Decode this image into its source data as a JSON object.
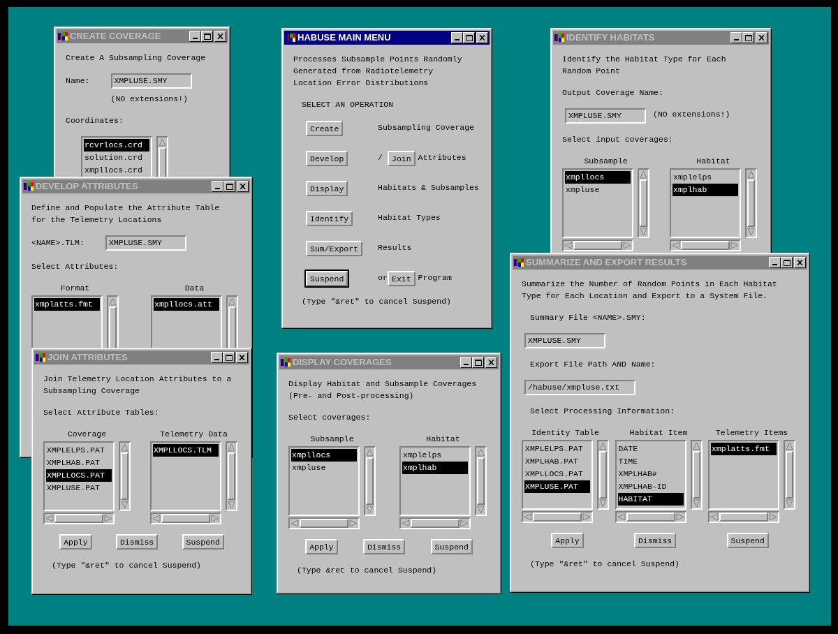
{
  "windows": [
    {
      "title": "CREATE COVERAGE",
      "active": false,
      "body": [
        {
          "kind": "paragraph",
          "text": "Create A Subsampling Coverage"
        },
        {
          "kind": "labeled_field",
          "label": "Name:",
          "value": "XMPLUSE.SMY",
          "note": "(NO extensions!)"
        },
        {
          "kind": "paragraph",
          "text": "Coordinates:"
        },
        {
          "kind": "lists",
          "lists": [
            {
              "items": [
                {
                  "text": "rcvrlocs.crd",
                  "selected": true
                },
                {
                  "text": "solution.crd",
                  "selected": false
                },
                {
                  "text": "xmpllocs.crd",
                  "selected": false
                }
              ]
            }
          ]
        }
      ]
    },
    {
      "title": "DEVELOP ATTRIBUTES",
      "active": false,
      "body": [
        {
          "kind": "paragraph",
          "text": "Define and Populate the Attribute Table\nfor the Telemetry Locations"
        },
        {
          "kind": "labeled_field",
          "label": "<NAME>.TLM:",
          "value": "XMPLUSE.SMY"
        },
        {
          "kind": "paragraph",
          "text": "Select Attributes:"
        },
        {
          "kind": "lists",
          "lists": [
            {
              "header": "Format",
              "items": [
                {
                  "text": "xmplatts.fmt",
                  "selected": true
                }
              ]
            },
            {
              "header": "Data",
              "items": [
                {
                  "text": "xmpllocs.att",
                  "selected": true
                }
              ]
            }
          ]
        }
      ]
    },
    {
      "title": "JOIN ATTRIBUTES",
      "active": false,
      "body": [
        {
          "kind": "paragraph",
          "text": "Join Telemetry Location Attributes to a\nSubsampling Coverage"
        },
        {
          "kind": "paragraph",
          "text": "Select Attribute Tables:"
        },
        {
          "kind": "lists",
          "lists": [
            {
              "header": "Coverage",
              "items": [
                {
                  "text": "XMPLELPS.PAT",
                  "selected": false
                },
                {
                  "text": "XMPLHAB.PAT",
                  "selected": false
                },
                {
                  "text": "XMPLLOCS.PAT",
                  "selected": true
                },
                {
                  "text": "XMPLUSE.PAT",
                  "selected": false
                }
              ]
            },
            {
              "header": "Telemetry Data",
              "items": [
                {
                  "text": "XMPLLOCS.TLM",
                  "selected": true
                }
              ]
            }
          ]
        },
        {
          "kind": "buttons",
          "buttons": [
            "Apply",
            "Dismiss",
            "Suspend"
          ]
        },
        {
          "kind": "paragraph",
          "text": "(Type \"&ret\" to cancel Suspend)",
          "indent": true
        }
      ]
    },
    {
      "title": "HABUSE MAIN MENU",
      "active": true,
      "body": [
        {
          "kind": "paragraph",
          "text": "Processes Subsample Points Randomly\nGenerated from Radiotelemetry\nLocation Error Distributions"
        },
        {
          "kind": "paragraph",
          "text": "SELECT AN OPERATION",
          "indent": true
        },
        {
          "kind": "menu",
          "rows": [
            {
              "button": {
                "label": "Create",
                "default": false
              },
              "text": "Subsampling Coverage"
            },
            {
              "button": {
                "label": "Develop",
                "default": false
              },
              "separator": "/",
              "second_button": {
                "label": "Join",
                "default": false
              },
              "text": "Attributes"
            },
            {
              "button": {
                "label": "Display",
                "default": false
              },
              "text": "Habitats & Subsamples"
            },
            {
              "button": {
                "label": "Identify",
                "default": false
              },
              "text": "Habitat Types"
            },
            {
              "button": {
                "label": "Sum/Export",
                "default": false
              },
              "text": "Results"
            },
            {
              "button": {
                "label": "Suspend",
                "default": true
              },
              "separator": "or",
              "second_button": {
                "label": "Exit",
                "default": false
              },
              "text": "Program"
            }
          ]
        },
        {
          "kind": "paragraph",
          "text": "(Type \"&ret\" to cancel Suspend)",
          "indent": true
        }
      ]
    },
    {
      "title": "DISPLAY COVERAGES",
      "active": false,
      "body": [
        {
          "kind": "paragraph",
          "text": "Display Habitat and Subsample Coverages\n(Pre- and Post-processing)"
        },
        {
          "kind": "paragraph",
          "text": "Select coverages:"
        },
        {
          "kind": "lists",
          "lists": [
            {
              "header": "Subsample",
              "items": [
                {
                  "text": "xmpllocs",
                  "selected": true
                },
                {
                  "text": "xmpluse",
                  "selected": false
                }
              ]
            },
            {
              "header": "Habitat",
              "items": [
                {
                  "text": "xmplelps",
                  "selected": false
                },
                {
                  "text": "xmplhab",
                  "selected": true
                }
              ]
            }
          ]
        },
        {
          "kind": "buttons",
          "buttons": [
            "Apply",
            "Dismiss",
            "Suspend"
          ]
        },
        {
          "kind": "paragraph",
          "text": "(Type &ret to cancel Suspend)",
          "indent": true
        }
      ]
    },
    {
      "title": "IDENTIFY HABITATS",
      "active": false,
      "body": [
        {
          "kind": "paragraph",
          "text": "Identify the Habitat Type for Each\nRandom Point"
        },
        {
          "kind": "paragraph",
          "text": "Output Coverage Name:"
        },
        {
          "kind": "field",
          "value": "XMPLUSE.SMY",
          "note": "(NO extensions!)"
        },
        {
          "kind": "paragraph",
          "text": "Select input coverages:"
        },
        {
          "kind": "lists",
          "lists": [
            {
              "header": "Subsample",
              "items": [
                {
                  "text": "xmpllocs",
                  "selected": true
                },
                {
                  "text": "xmpluse",
                  "selected": false
                }
              ]
            },
            {
              "header": "Habitat",
              "items": [
                {
                  "text": "xmplelps",
                  "selected": false
                },
                {
                  "text": "xmplhab",
                  "selected": true
                }
              ]
            }
          ]
        }
      ]
    },
    {
      "title": "SUMMARIZE AND EXPORT RESULTS",
      "active": false,
      "body": [
        {
          "kind": "paragraph",
          "text": "Summarize the Number of Random Points in Each Habitat\nType for Each Location and Export to a System File."
        },
        {
          "kind": "paragraph",
          "text": "Summary File <NAME>.SMY:",
          "indent": true
        },
        {
          "kind": "field",
          "value": "XMPLUSE.SMY"
        },
        {
          "kind": "paragraph",
          "text": "Export File Path AND Name:",
          "indent": true
        },
        {
          "kind": "field",
          "value": "/habuse/xmpluse.txt"
        },
        {
          "kind": "paragraph",
          "text": "Select Processing Information:",
          "indent": true
        },
        {
          "kind": "lists",
          "lists": [
            {
              "header": "Identity Table",
              "items": [
                {
                  "text": "XMPLELPS.PAT",
                  "selected": false
                },
                {
                  "text": "XMPLHAB.PAT",
                  "selected": false
                },
                {
                  "text": "XMPLLOCS.PAT",
                  "selected": false
                },
                {
                  "text": "XMPLUSE.PAT",
                  "selected": true
                }
              ]
            },
            {
              "header": "Habitat Item",
              "items": [
                {
                  "text": "DATE",
                  "selected": false
                },
                {
                  "text": "TIME",
                  "selected": false
                },
                {
                  "text": "XMPLHAB#",
                  "selected": false
                },
                {
                  "text": "XMPLHAB-ID",
                  "selected": false
                },
                {
                  "text": "HABITAT",
                  "selected": true
                }
              ]
            },
            {
              "header": "Telemetry Items",
              "items": [
                {
                  "text": "xmplatts.fmt",
                  "selected": true
                }
              ]
            }
          ]
        },
        {
          "kind": "buttons",
          "buttons": [
            "Apply",
            "Dismiss",
            "Suspend"
          ]
        },
        {
          "kind": "paragraph",
          "text": "(Type \"&ret\" to cancel Suspend)",
          "indent": true
        }
      ]
    }
  ]
}
